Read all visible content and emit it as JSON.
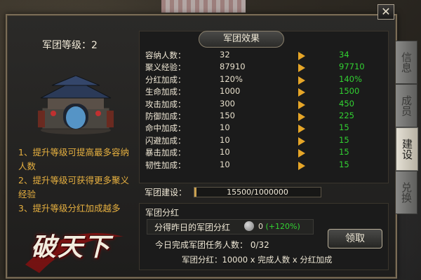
{
  "window": {
    "close_label": "✕"
  },
  "level": "军团等级：2",
  "tips": [
    "1、提升等级可提高最多容纳人数",
    "2、提升等级可获得更多聚义经验",
    "3、提升等级分红加成越多"
  ],
  "logo_text": "破天下",
  "effects": {
    "title": "军团效果",
    "rows": [
      {
        "label": "容纳人数：",
        "current": "32",
        "next": "34"
      },
      {
        "label": "聚义经验：",
        "current": "87910",
        "next": "97710"
      },
      {
        "label": "分红加成：",
        "current": "120%",
        "next": "140%"
      },
      {
        "label": "生命加成：",
        "current": "1000",
        "next": "1500"
      },
      {
        "label": "攻击加成：",
        "current": "300",
        "next": "450"
      },
      {
        "label": "防御加成：",
        "current": "150",
        "next": "225"
      },
      {
        "label": "命中加成：",
        "current": "10",
        "next": "15"
      },
      {
        "label": "闪避加成：",
        "current": "10",
        "next": "15"
      },
      {
        "label": "暴击加成：",
        "current": "10",
        "next": "15"
      },
      {
        "label": "韧性加成：",
        "current": "10",
        "next": "15"
      }
    ]
  },
  "construction": {
    "label": "军团建设：",
    "text": "15500/1000000",
    "progress": 0.0155
  },
  "dividend": {
    "title": "军团分红",
    "yesterday_label": "分得昨日的军团分红",
    "yesterday_value": "0",
    "yesterday_pct": "(+120%)",
    "task_line": "今日完成军团任务人数：  0/32",
    "formula": "军团分红：10000  x  完成人数  x  分红加成",
    "claim_label": "领取"
  },
  "side_tabs": [
    {
      "label": "信息",
      "active": false
    },
    {
      "label": "成员",
      "active": false
    },
    {
      "label": "建设",
      "active": true
    },
    {
      "label": "兑换",
      "active": false
    }
  ],
  "colors": {
    "accent_gold": "#e6b040",
    "up_green": "#32d232",
    "arrow": "#e6a628"
  }
}
